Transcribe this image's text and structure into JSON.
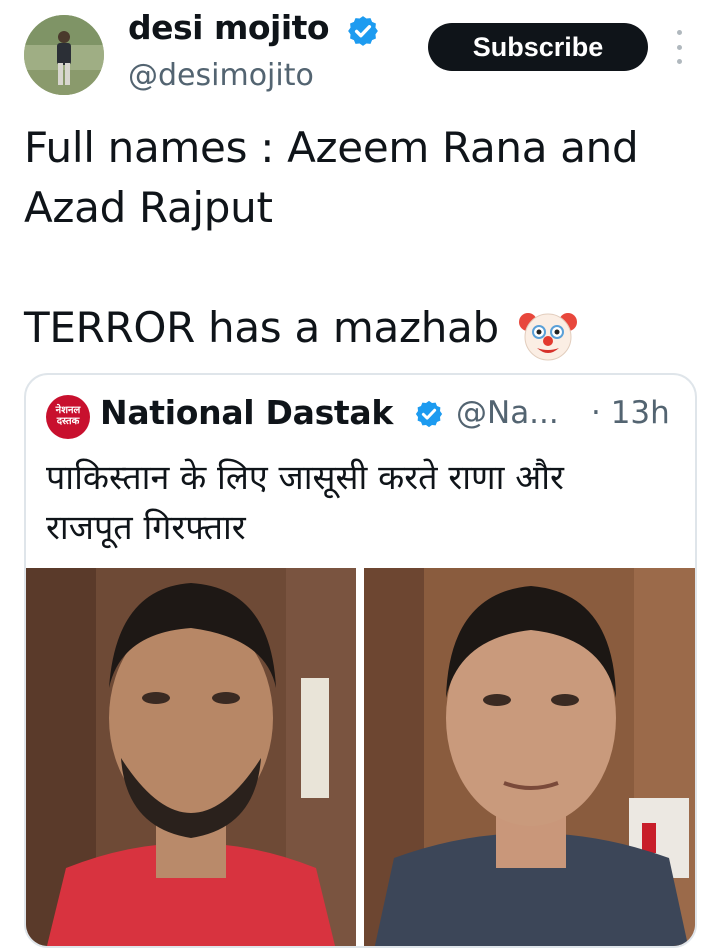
{
  "author": {
    "display_name": "desi mojito",
    "handle": "@desimojito",
    "verified_icon": "verified-badge-icon",
    "verified_color": "#1d9bf0"
  },
  "actions": {
    "subscribe_label": "Subscribe",
    "more_icon": "more-vertical-icon"
  },
  "tweet": {
    "lines": [
      "Full names : Azeem Rana and",
      "Azad Rajput",
      "",
      "TERROR has a mazhab"
    ],
    "emoji_icon": "clown-face-icon"
  },
  "quoted_tweet": {
    "author_name": "National Dastak",
    "handle": "@Na...",
    "time": "· 13h",
    "logo_text_top": "नेशनल",
    "logo_text_bottom": "दस्तक",
    "logo_color": "#c8102e",
    "text_lines": [
      "पाकिस्तान के लिए जासूसी करते राणा और",
      "राजपूत गिरफ्तार"
    ],
    "images": [
      "photo-man-red-shirt",
      "photo-man-grey-shirt"
    ]
  },
  "colors": {
    "text": "#0f1419",
    "secondary_text": "#536471",
    "accent": "#1d9bf0",
    "border": "#dfe5ea",
    "button_bg": "#0f1419"
  }
}
